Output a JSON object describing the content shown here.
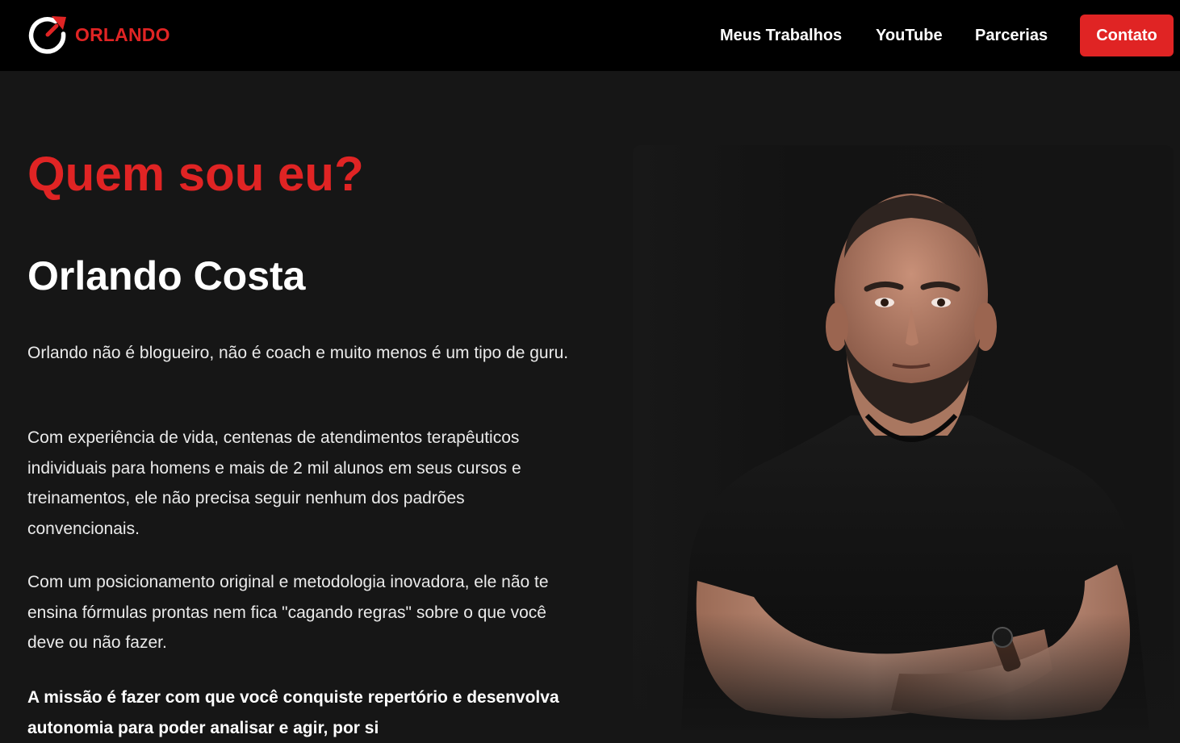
{
  "colors": {
    "accent": "#e02424",
    "background": "#161616",
    "nav_bg": "#000000"
  },
  "brand": {
    "name": "ORLANDO",
    "logo_icon": "power-refresh-logo-icon"
  },
  "nav": {
    "links": [
      "Meus Trabalhos",
      "YouTube",
      "Parcerias"
    ],
    "cta": "Contato"
  },
  "about": {
    "title": "Quem sou eu?",
    "name": "Orlando Costa",
    "paragraphs": [
      "Orlando não é blogueiro, não é coach e muito menos é um tipo de guru.",
      "Com experiência de vida, centenas de atendimentos terapêuticos individuais para homens e mais de 2 mil alunos em seus cursos e treinamentos, ele não precisa seguir nenhum dos padrões convencionais.",
      "Com um posicionamento original e metodologia inovadora, ele não te ensina fórmulas prontas nem fica \"cagando regras\" sobre o que você deve ou não fazer.",
      "A missão é fazer com que você conquiste repertório e desenvolva autonomia para poder analisar e agir, por si"
    ],
    "photo_icon": "portrait-photo-icon"
  }
}
